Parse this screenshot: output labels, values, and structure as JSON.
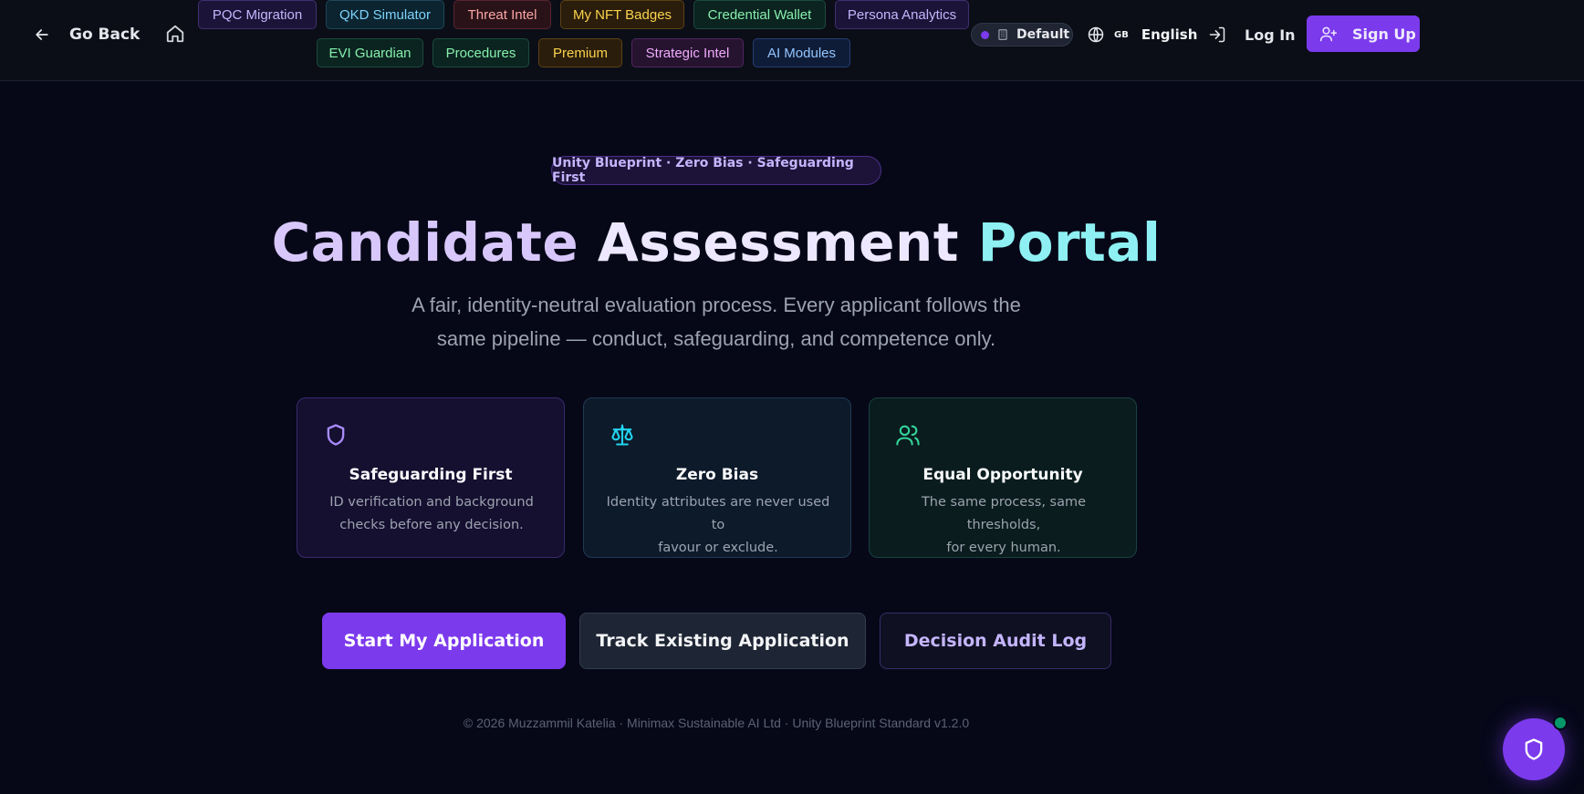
{
  "header": {
    "go_back_label": "Go Back",
    "nav_pills_row1": [
      {
        "label": "PQC Migration",
        "color": "purple"
      },
      {
        "label": "QKD Simulator",
        "color": "cyan"
      },
      {
        "label": "Threat Intel",
        "color": "red"
      },
      {
        "label": "My NFT Badges",
        "color": "amber"
      },
      {
        "label": "Credential Wallet",
        "color": "green"
      },
      {
        "label": "Persona Analytics",
        "color": "purple"
      }
    ],
    "nav_pills_row2": [
      {
        "label": "EVI Guardian",
        "color": "green"
      },
      {
        "label": "Procedures",
        "color": "green"
      },
      {
        "label": "Premium",
        "color": "amber"
      },
      {
        "label": "Strategic Intel",
        "color": "pink"
      },
      {
        "label": "AI Modules",
        "color": "blue"
      }
    ],
    "theme_label": "Default",
    "language_code": "GB",
    "language_label": "English",
    "login_label": "Log In",
    "signup_label": "Sign Up"
  },
  "hero": {
    "badge": "Unity Blueprint · Zero Bias · Safeguarding First",
    "title_part1": "Candidate",
    "title_part2": "Assessment",
    "title_part3": "Portal",
    "subtitle_line1": "A fair, identity-neutral evaluation process. Every applicant follows the",
    "subtitle_line2": "same pipeline — conduct, safeguarding, and competence only."
  },
  "cards": [
    {
      "icon": "shield-icon",
      "title": "Safeguarding First",
      "desc_line1": "ID verification and background",
      "desc_line2": "checks before any decision."
    },
    {
      "icon": "scale-icon",
      "title": "Zero Bias",
      "desc_line1": "Identity attributes are never used to",
      "desc_line2": "favour or exclude."
    },
    {
      "icon": "users-icon",
      "title": "Equal Opportunity",
      "desc_line1": "The same process, same thresholds,",
      "desc_line2": "for every human."
    }
  ],
  "actions": {
    "start_label": "Start My Application",
    "track_label": "Track Existing Application",
    "audit_label": "Decision Audit Log"
  },
  "footer": {
    "text": "© 2026 Muzzammil Katelia · Minimax Sustainable AI Ltd · Unity Blueprint Standard v1.2.0"
  },
  "colors": {
    "background": "#060818",
    "accent": "#7c3aed",
    "title_gradient_start": "#d8c7fa",
    "title_gradient_end": "#8ef0f2",
    "status_online": "#059669"
  }
}
